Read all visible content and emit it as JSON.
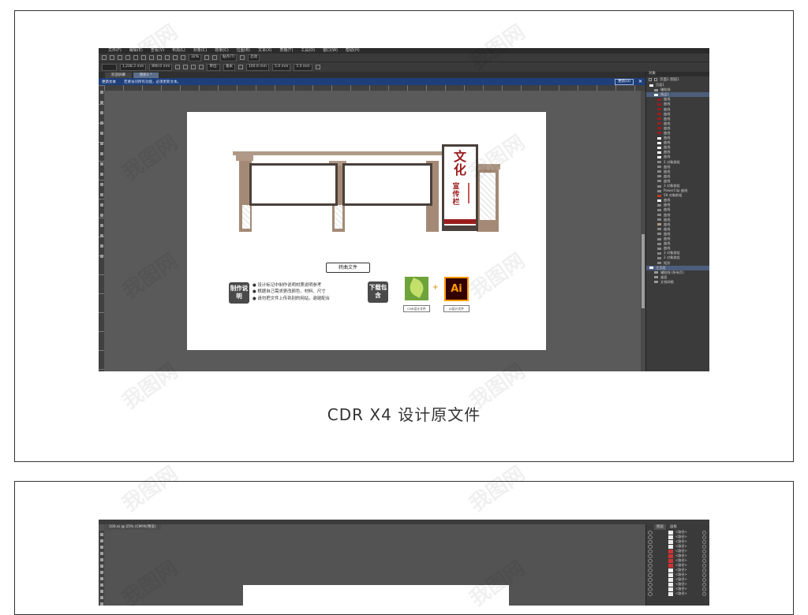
{
  "watermark": "我图网",
  "caption": "CDR X4 设计原文件",
  "cdr": {
    "menu": [
      "文件(F)",
      "编辑(E)",
      "查看(V)",
      "布局(L)",
      "对象(C)",
      "效果(C)",
      "位图(B)",
      "文本(X)",
      "表格(T)",
      "工具(O)",
      "窗口(W)",
      "帮助(H)"
    ],
    "toolbar": {
      "zoom": "32%",
      "snap": "贴齐(T)",
      "launch": "启动",
      "width": "1,208.2 mm",
      "height": "890.0 mm",
      "units": "单位:",
      "unit_value": "毫米",
      "nudge": "100.0 mm",
      "dup_x": "5.0 mm",
      "dup_y": "5.0 mm"
    },
    "tabs": [
      "欢迎屏幕",
      "图形1 *"
    ],
    "notice": {
      "title": "更新文本",
      "message": "若要访问所有功能，必须更新文本。",
      "button": "更新(U)"
    },
    "docker": {
      "title": "对象",
      "header": "页面1   图层1",
      "objects": [
        {
          "label": "页面1",
          "level": 0,
          "color": "#ffffff"
        },
        {
          "label": "辅助线",
          "level": 1,
          "color": "#999999"
        },
        {
          "label": "图层1",
          "level": 1,
          "color": "#ffffff",
          "selected": true
        },
        {
          "label": "曲线",
          "level": 2,
          "color": "#9a1d1d"
        },
        {
          "label": "曲线",
          "level": 2,
          "color": "#9a1d1d"
        },
        {
          "label": "曲线",
          "level": 2,
          "color": "#9a1d1d"
        },
        {
          "label": "曲线",
          "level": 2,
          "color": "#9a1d1d"
        },
        {
          "label": "曲线",
          "level": 2,
          "color": "#9a1d1d"
        },
        {
          "label": "曲线",
          "level": 2,
          "color": "#9a1d1d"
        },
        {
          "label": "曲线",
          "level": 2,
          "color": "#9a1d1d"
        },
        {
          "label": "曲线",
          "level": 2,
          "color": "#9a1d1d"
        },
        {
          "label": "曲线",
          "level": 2,
          "color": "#ffffff"
        },
        {
          "label": "曲线",
          "level": 2,
          "color": "#ffffff"
        },
        {
          "label": "曲线",
          "level": 2,
          "color": "#ffffff"
        },
        {
          "label": "曲线",
          "level": 2,
          "color": "#ffffff"
        },
        {
          "label": "曲线",
          "level": 2,
          "color": "#ffffff"
        },
        {
          "label": "2 对象群组",
          "level": 2,
          "color": "#888888"
        },
        {
          "label": "曲线",
          "level": 2,
          "color": "#888888"
        },
        {
          "label": "曲线",
          "level": 2,
          "color": "#888888"
        },
        {
          "label": "曲线",
          "level": 2,
          "color": "#888888"
        },
        {
          "label": "曲线",
          "level": 2,
          "color": "#888888"
        },
        {
          "label": "3 对象群组",
          "level": 2,
          "color": "#888888"
        },
        {
          "label": "PowerClip 曲线",
          "level": 2,
          "color": "#888888"
        },
        {
          "label": "59 对象群组",
          "level": 2,
          "color": "#c23b22"
        },
        {
          "label": "曲线",
          "level": 2,
          "color": "#ffffff"
        },
        {
          "label": "曲线",
          "level": 2,
          "color": "#888888"
        },
        {
          "label": "曲线",
          "level": 2,
          "color": "#888888"
        },
        {
          "label": "曲线",
          "level": 2,
          "color": "#888888"
        },
        {
          "label": "曲线",
          "level": 2,
          "color": "#888888"
        },
        {
          "label": "曲线",
          "level": 2,
          "color": "#b09a87"
        },
        {
          "label": "曲线",
          "level": 2,
          "color": "#888888"
        },
        {
          "label": "曲线",
          "level": 2,
          "color": "#888888"
        },
        {
          "label": "曲线",
          "level": 2,
          "color": "#888888"
        },
        {
          "label": "曲线",
          "level": 2,
          "color": "#888888"
        },
        {
          "label": "曲线",
          "level": 2,
          "color": "#888888"
        },
        {
          "label": "3 对象群组",
          "level": 2,
          "color": "#888888"
        },
        {
          "label": "2 对象群组",
          "level": 2,
          "color": "#888888"
        },
        {
          "label": "矩形",
          "level": 2,
          "color": "#888888"
        },
        {
          "label": "主页面",
          "level": 0,
          "color": "#ffffff",
          "selected": true
        },
        {
          "label": "辅助线 (所有页)",
          "level": 1,
          "color": "#999999"
        },
        {
          "label": "桌面",
          "level": 1,
          "color": "#999999"
        },
        {
          "label": "文档网格",
          "level": 1,
          "color": "#999999"
        }
      ]
    },
    "design": {
      "board_title": "文化",
      "board_sub": "宣传栏",
      "convert_label": "转曲文件",
      "notes_badge": "制作说明",
      "notes": [
        "● 设计标记中制作说明材质说明参考",
        "● 根据自己需求更改颜色、材料、尺寸",
        "● 请勿把文件上传到别的网站，谢谢配合"
      ],
      "download_badge": "下载包含",
      "cdr_file_label": "CDR设计文件",
      "ai_file_label": "AI设计文件",
      "ai_logo": "Ai",
      "plus": "+"
    }
  },
  "ai": {
    "doc_tab": "100.ai @ 25% (CMYK/预览)",
    "panel_tabs": [
      "图层",
      "画板"
    ],
    "layers": [
      "<路径>",
      "<路径>",
      "<路径>",
      "<路径>",
      "<路径>",
      "<路径>",
      "<路径>",
      "<路径>",
      "<路径>",
      "<路径>",
      "<路径>",
      "<路径>",
      "<路径>",
      "<路径>"
    ]
  }
}
